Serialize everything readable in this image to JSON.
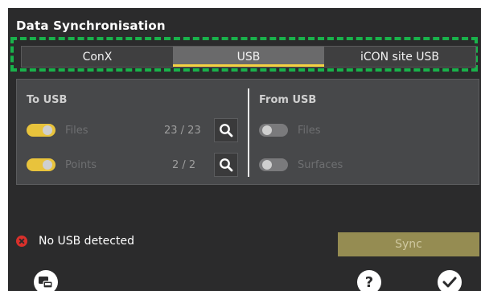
{
  "dialog": {
    "title": "Data Synchronisation"
  },
  "tabs": [
    {
      "label": "ConX",
      "active": false
    },
    {
      "label": "USB",
      "active": true
    },
    {
      "label": "iCON site USB",
      "active": false
    }
  ],
  "to_usb": {
    "title": "To USB",
    "rows": [
      {
        "label": "Files",
        "count": "23 / 23",
        "enabled": true
      },
      {
        "label": "Points",
        "count": "2 / 2",
        "enabled": true
      }
    ]
  },
  "from_usb": {
    "title": "From USB",
    "rows": [
      {
        "label": "Files",
        "enabled": false
      },
      {
        "label": "Surfaces",
        "enabled": false
      }
    ]
  },
  "status": {
    "text": "No USB detected",
    "icon": "error-icon"
  },
  "actions": {
    "sync_label": "Sync"
  },
  "footer": {
    "left_icon": "device-icon",
    "help_icon": "help-icon",
    "confirm_icon": "check-icon"
  },
  "colors": {
    "accent": "#f5d242",
    "highlight_outline": "#19b24b",
    "error": "#d9302b"
  }
}
